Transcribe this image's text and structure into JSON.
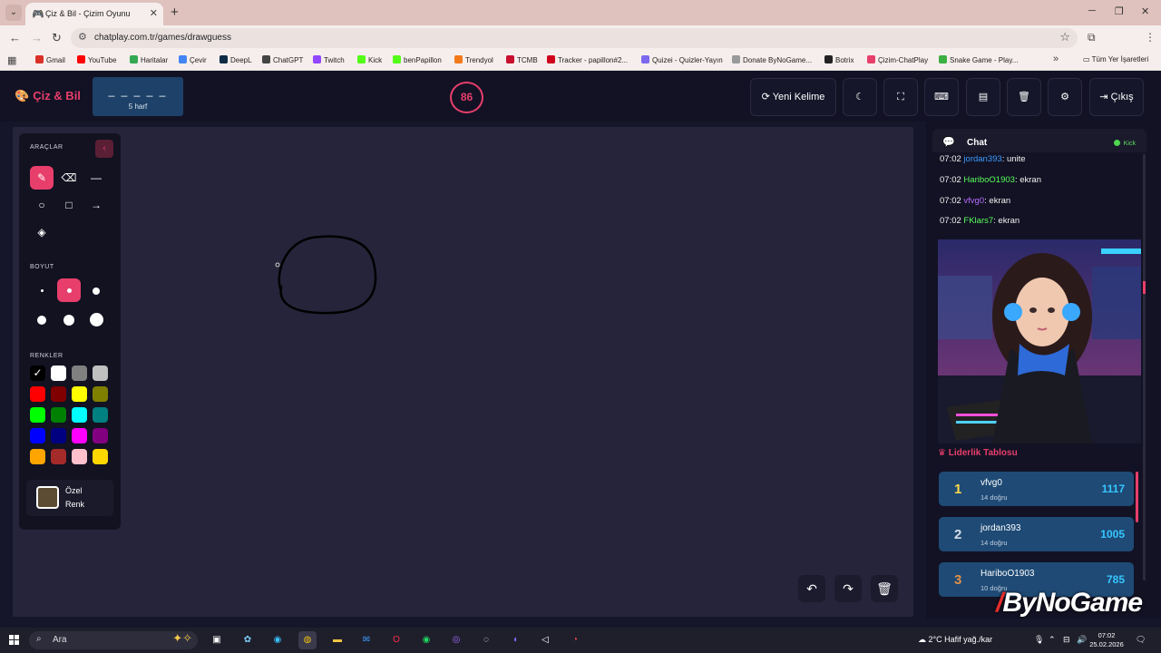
{
  "browser": {
    "tab_title": "Çiz & Bil - Çizim Oyunu",
    "url": "chatplay.com.tr/games/drawguess",
    "bookmarks": [
      {
        "label": "Gmail",
        "color": "#d93025"
      },
      {
        "label": "YouTube",
        "color": "#ff0000"
      },
      {
        "label": "Haritalar",
        "color": "#34a853"
      },
      {
        "label": "Çevir",
        "color": "#4285f4"
      },
      {
        "label": "DeepL",
        "color": "#0f2b46"
      },
      {
        "label": "ChatGPT",
        "color": "#444444"
      },
      {
        "label": "Twitch",
        "color": "#9146ff"
      },
      {
        "label": "Kick",
        "color": "#53fc18"
      },
      {
        "label": "benPapillon",
        "color": "#53fc18"
      },
      {
        "label": "Trendyol",
        "color": "#f27a1a"
      },
      {
        "label": "TCMB",
        "color": "#c8102e"
      },
      {
        "label": "Tracker - papillon#2...",
        "color": "#d0021b"
      },
      {
        "label": "Quizei - Quizler-Yayın",
        "color": "#7b68ee"
      },
      {
        "label": "Donate ByNoGame...",
        "color": "#999999"
      },
      {
        "label": "Botrix",
        "color": "#222222"
      },
      {
        "label": "Çizim-ChatPlay",
        "color": "#e83e6b"
      },
      {
        "label": "Snake Game - Play..."
      }
    ],
    "all_bookmarks": "Tüm Yer İşaretleri"
  },
  "header": {
    "logo": "Çiz & Bil",
    "word_blanks": "_ _ _ _ _",
    "word_length": "5 harf",
    "timer": "86",
    "new_word": "Yeni Kelime",
    "exit": "Çıkış"
  },
  "tools": {
    "tools_label": "ARAÇLAR",
    "size_label": "BOYUT",
    "colors_label": "RENKLER",
    "custom_color_line1": "Özel",
    "custom_color_line2": "Renk",
    "colors": [
      "#000000",
      "#ffffff",
      "#808080",
      "#c0c0c0",
      "#ff0000",
      "#800000",
      "#ffff00",
      "#808000",
      "#00ff00",
      "#008000",
      "#00ffff",
      "#008080",
      "#0000ff",
      "#000080",
      "#ff00ff",
      "#800080",
      "#ffa500",
      "#a52a2a",
      "#ffc0cb",
      "#ffd700"
    ],
    "custom_color": "#5b4c33"
  },
  "chat": {
    "title": "Chat",
    "platform": "Kick",
    "messages": [
      {
        "time": "07:02",
        "user": "jordan393",
        "text": ": unite"
      },
      {
        "time": "07:02",
        "user": "HariboO1903",
        "text": ": ekran"
      },
      {
        "time": "07:02",
        "user": "vfvg0",
        "text": ": ekran"
      },
      {
        "time": "07:02",
        "user": "FKlars7",
        "text": ": ekran"
      }
    ]
  },
  "leaderboard": {
    "title": "Liderlik Tablosu",
    "rows": [
      {
        "rank": "1",
        "name": "vfvg0",
        "sub": "14 doğru",
        "score": "1117",
        "rank_color": "#ffd84a"
      },
      {
        "rank": "2",
        "name": "jordan393",
        "sub": "14 doğru",
        "score": "1005",
        "rank_color": "#d7dde6"
      },
      {
        "rank": "3",
        "name": "HariboO1903",
        "sub": "10 doğru",
        "score": "785",
        "rank_color": "#e0914a"
      }
    ]
  },
  "watermark": "ByNoGame",
  "taskbar": {
    "search_placeholder": "Ara",
    "weather": "2°C  Hafif yağ./kar",
    "time": "07:02",
    "date": "25.02.2026"
  }
}
